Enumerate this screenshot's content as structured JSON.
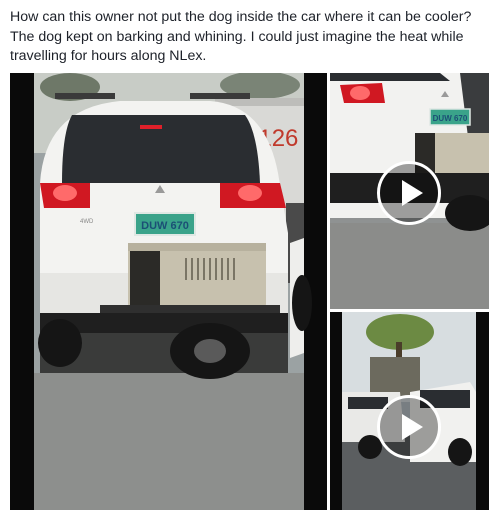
{
  "post": {
    "text": "How can this owner not put the dog inside the car where it can be cooler?\nThe dog kept on barking and whining. I could just imagine the heat while travelling for hours along NLex."
  },
  "media": {
    "main_video": {
      "truck_sign": "-9126",
      "plate": "DUW 670",
      "badge": "4WD"
    },
    "thumb_top": {
      "plate": "DUW 670",
      "play_icon": "play-icon"
    },
    "thumb_bottom": {
      "play_icon": "play-icon"
    }
  },
  "colors": {
    "page_bg": "#ffffff",
    "text": "#1d2129",
    "tile_bg": "#000000",
    "plate_green": "#3aa38a",
    "taillight_red": "#e0202a"
  }
}
